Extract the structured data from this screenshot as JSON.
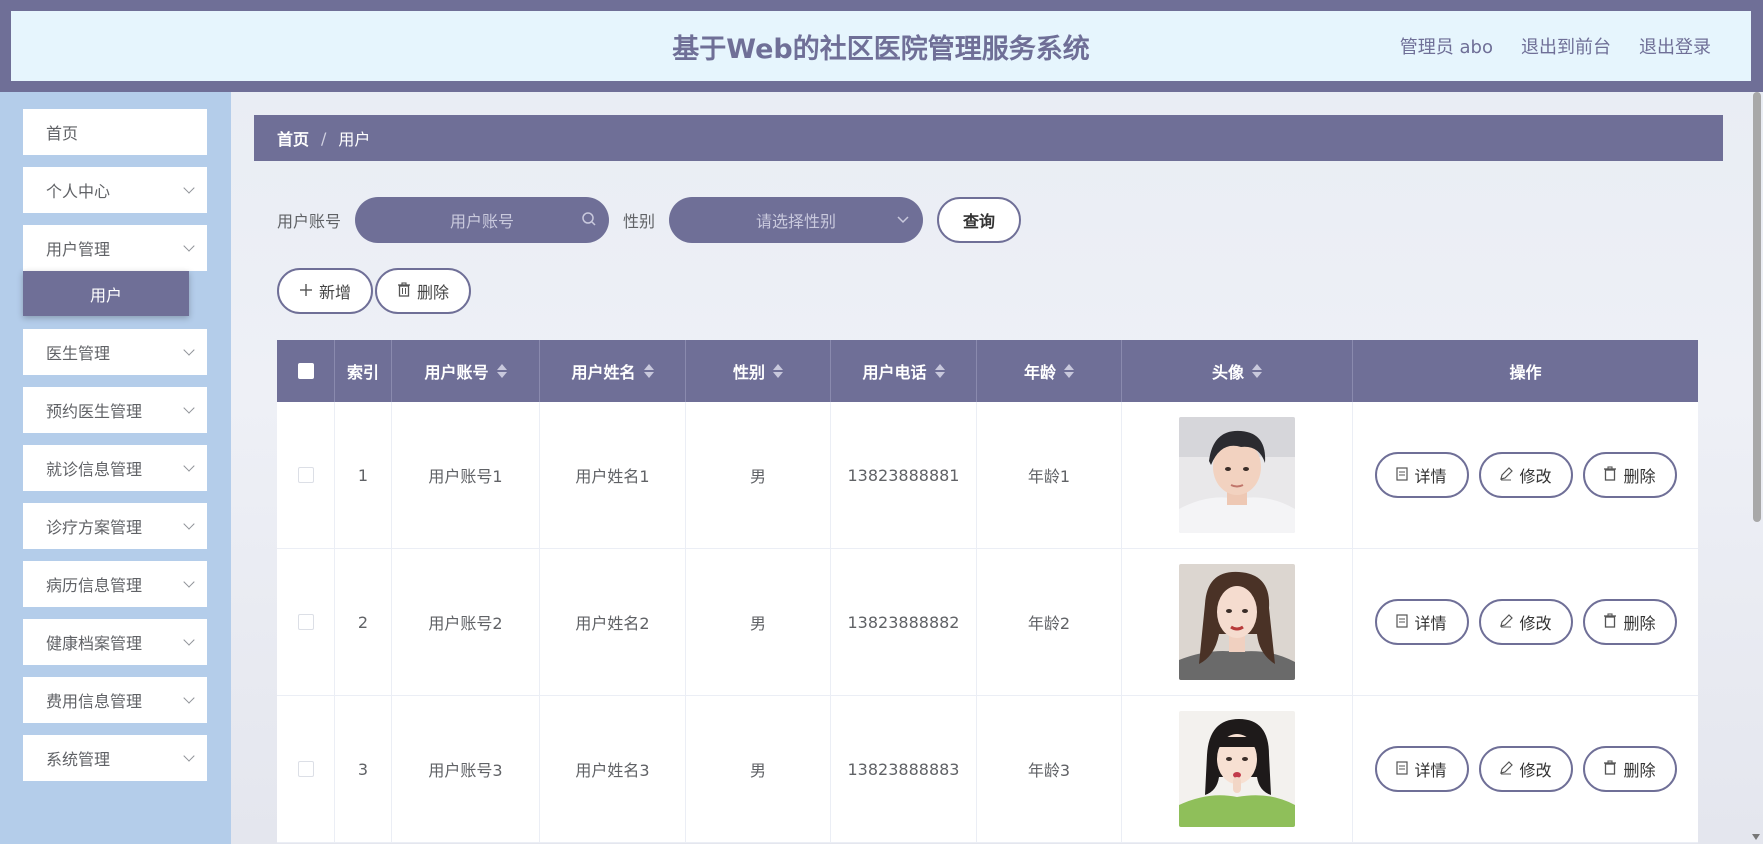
{
  "header": {
    "title": "基于Web的社区医院管理服务系统",
    "admin_label": "管理员 abo",
    "front_label": "退出到前台",
    "logout_label": "退出登录"
  },
  "sidebar": {
    "items": [
      {
        "label": "首页"
      },
      {
        "label": "个人中心"
      },
      {
        "label": "用户管理"
      },
      {
        "label": "医生管理"
      },
      {
        "label": "预约医生管理"
      },
      {
        "label": "就诊信息管理"
      },
      {
        "label": "诊疗方案管理"
      },
      {
        "label": "病历信息管理"
      },
      {
        "label": "健康档案管理"
      },
      {
        "label": "费用信息管理"
      },
      {
        "label": "系统管理"
      }
    ],
    "active_sub": "用户"
  },
  "breadcrumb": {
    "home": "首页",
    "sep": "/",
    "current": "用户"
  },
  "search": {
    "account_label": "用户账号",
    "account_placeholder": "用户账号",
    "gender_label": "性别",
    "gender_placeholder": "请选择性别",
    "query_label": "查询"
  },
  "actions": {
    "add_label": "新增",
    "delete_label": "删除"
  },
  "table": {
    "headers": {
      "index": "索引",
      "account": "用户账号",
      "name": "用户姓名",
      "gender": "性别",
      "phone": "用户电话",
      "age": "年龄",
      "avatar": "头像",
      "ops": "操作"
    },
    "rows": [
      {
        "index": "1",
        "account": "用户账号1",
        "name": "用户姓名1",
        "gender": "男",
        "phone": "13823888881",
        "age": "年龄1"
      },
      {
        "index": "2",
        "account": "用户账号2",
        "name": "用户姓名2",
        "gender": "男",
        "phone": "13823888882",
        "age": "年龄2"
      },
      {
        "index": "3",
        "account": "用户账号3",
        "name": "用户姓名3",
        "gender": "男",
        "phone": "13823888883",
        "age": "年龄3"
      }
    ],
    "op_labels": {
      "detail": "详情",
      "edit": "修改",
      "delete": "删除"
    }
  },
  "colors": {
    "accent": "#6f6f97",
    "header_bg": "#e6f5fd",
    "sidebar_bg": "#b4cdea"
  }
}
